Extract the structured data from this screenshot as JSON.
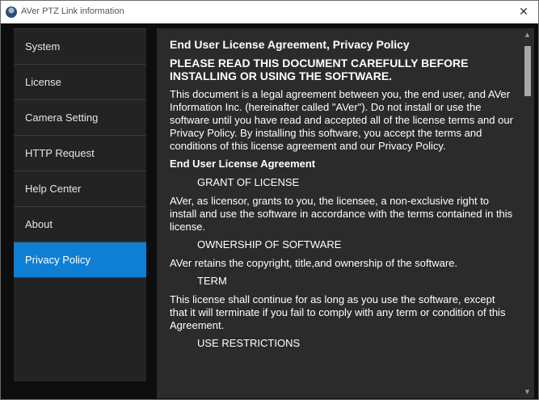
{
  "window": {
    "title": "AVer PTZ Link information",
    "close_glyph": "✕"
  },
  "sidebar": {
    "items": [
      {
        "label": "System",
        "active": false
      },
      {
        "label": "License",
        "active": false
      },
      {
        "label": "Camera Setting",
        "active": false
      },
      {
        "label": "HTTP Request",
        "active": false
      },
      {
        "label": "Help Center",
        "active": false
      },
      {
        "label": "About",
        "active": false
      },
      {
        "label": "Privacy Policy",
        "active": true
      }
    ]
  },
  "content": {
    "title": "End User License Agreement, Privacy Policy",
    "warning": "PLEASE READ THIS DOCUMENT CAREFULLY BEFORE INSTALLING OR USING THE SOFTWARE.",
    "intro": "This document is a legal agreement between you, the end user, and AVer Information Inc. (hereinafter called \"AVer\"). Do not install or use the software until you have read and accepted all of the license terms and our Privacy Policy. By installing this software, you accept the terms and conditions of this license agreement and our Privacy Policy.",
    "eula_heading": "End User License Agreement",
    "grant_heading": "GRANT OF LICENSE",
    "grant_text": "AVer, as licensor, grants to you, the licensee, a non-exclusive right to install and use the software in accordance with the terms contained in this license.",
    "ownership_heading": "OWNERSHIP OF SOFTWARE",
    "ownership_text": "AVer retains the copyright, title,and ownership of the software.",
    "term_heading": "TERM",
    "term_text": "This license shall continue for as long as you use the software, except that it will terminate if you fail to comply with any term or condition of this Agreement.",
    "use_heading": "USE RESTRICTIONS"
  },
  "scrollbar": {
    "up_glyph": "▲",
    "down_glyph": "▼"
  },
  "colors": {
    "active_nav": "#0f7fd3",
    "sidebar_bg": "#232323",
    "content_bg": "#2b2b2b",
    "window_bg": "#0d0d0d"
  }
}
